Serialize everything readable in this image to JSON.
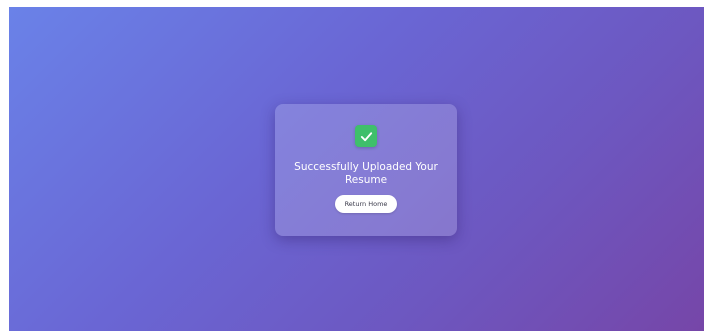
{
  "upload_success": {
    "message": "Successfully Uploaded Your Resume",
    "status_icon": "check-icon",
    "return_home_label": "Return Home"
  },
  "colors": {
    "background_start": "#6a82e8",
    "background_end": "#7646a8",
    "check_green": "#3fbf6b",
    "button_bg": "#ffffff"
  }
}
